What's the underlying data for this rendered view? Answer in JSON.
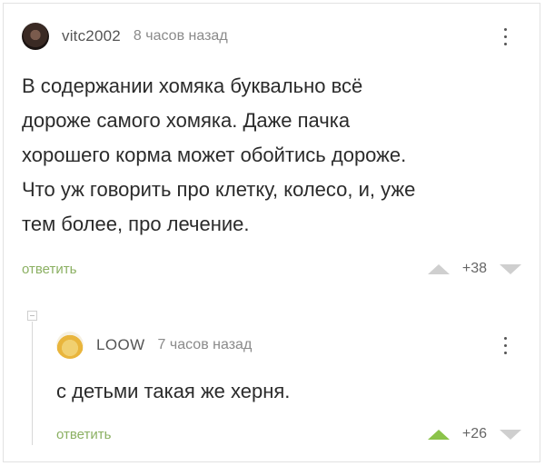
{
  "comments": [
    {
      "username": "vitc2002",
      "time": "8 часов назад",
      "text": "В содержании хомяка буквально всё\nдороже самого хомяка. Даже пачка\nхорошего корма может обойтись дороже.\nЧто уж говорить про клетку, колесо, и, уже\nтем более, про лечение.",
      "reply_label": "ответить",
      "score": "+38"
    },
    {
      "username": "LOOW",
      "time": "7 часов назад",
      "text": "с детьми такая же херня.",
      "reply_label": "ответить",
      "score": "+26"
    }
  ],
  "colors": {
    "reply_link": "#8bb062",
    "upvote_active": "#8bc34a",
    "vote_inactive": "#cfcfcf"
  }
}
